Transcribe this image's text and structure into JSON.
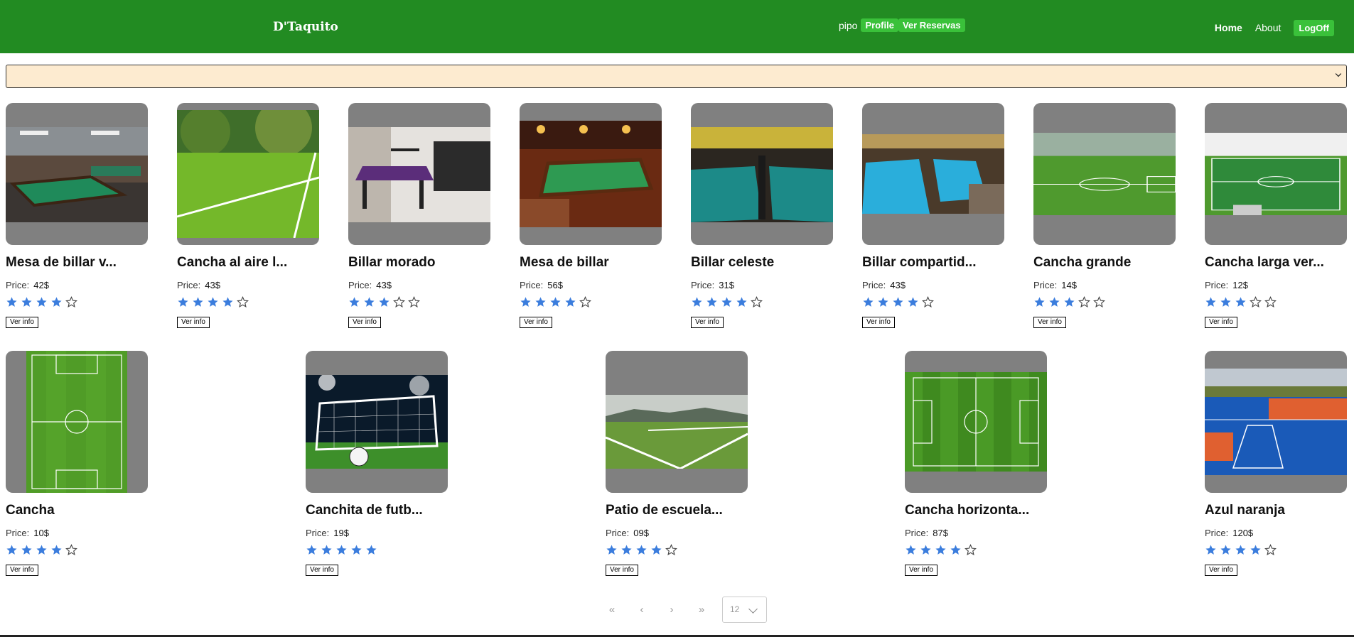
{
  "nav": {
    "brand": "D'Taquito",
    "username": "pipo",
    "profile_label": "Profile",
    "reservas_label": "Ver Reservas",
    "home_label": "Home",
    "about_label": "About",
    "logoff_label": "LogOff"
  },
  "filter": {
    "selected": ""
  },
  "card_common": {
    "price_label": "Price:",
    "button_label": "Ver info"
  },
  "products": [
    {
      "title": "Mesa de billar v...",
      "price": "42$",
      "rating": 4
    },
    {
      "title": "Cancha al aire l...",
      "price": "43$",
      "rating": 4
    },
    {
      "title": "Billar morado",
      "price": "43$",
      "rating": 3
    },
    {
      "title": "Mesa de billar",
      "price": "56$",
      "rating": 4
    },
    {
      "title": "Billar celeste",
      "price": "31$",
      "rating": 4
    },
    {
      "title": "Billar compartid...",
      "price": "43$",
      "rating": 4
    },
    {
      "title": "Cancha grande",
      "price": "14$",
      "rating": 3
    },
    {
      "title": "Cancha larga ver...",
      "price": "12$",
      "rating": 3
    },
    {
      "title": "Cancha",
      "price": "10$",
      "rating": 4
    },
    {
      "title": "Canchita de futb...",
      "price": "19$",
      "rating": 5
    },
    {
      "title": "Patio de escuela...",
      "price": "09$",
      "rating": 4
    },
    {
      "title": "Cancha horizonta...",
      "price": "87$",
      "rating": 4
    },
    {
      "title": "Azul naranja",
      "price": "120$",
      "rating": 4
    }
  ],
  "pagination": {
    "first": "«",
    "prev": "‹",
    "next": "›",
    "last": "»",
    "page_size": "12"
  },
  "colors": {
    "navbar": "#228b22",
    "pill": "#3ac13a",
    "star": "#3b7ddd",
    "filter_bg": "#fdebd0"
  }
}
